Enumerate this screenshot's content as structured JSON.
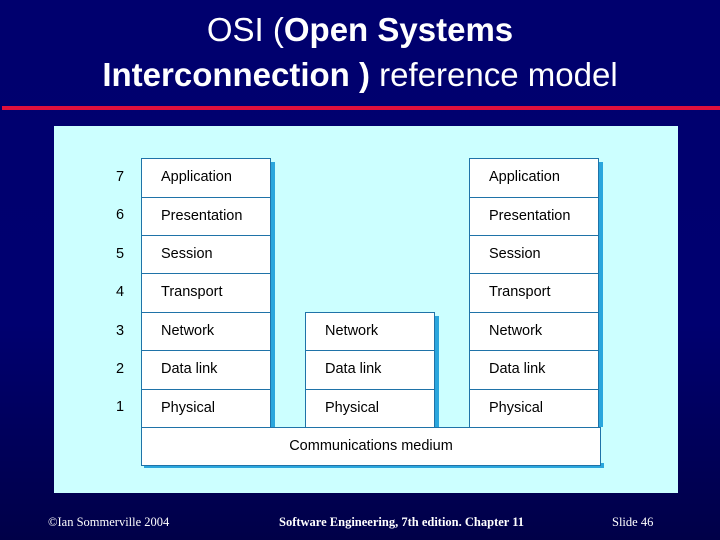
{
  "slide": {
    "title": {
      "line1_normal": "OSI (",
      "line1_bold": "Open Systems",
      "line2_bold": "Interconnection )",
      "line2_normal": " reference model"
    },
    "colors": {
      "background": "#00006e",
      "rule": "#e0103c",
      "panel": "#ccffff",
      "cell_border": "#1f73a8",
      "cell_shadow": "#2aa6dd"
    },
    "diagram": {
      "layer_numbers": [
        "7",
        "6",
        "5",
        "4",
        "3",
        "2",
        "1"
      ],
      "left_stack": [
        "Application",
        "Presentation",
        "Session",
        "Transport",
        "Network",
        "Data link",
        "Physical"
      ],
      "middle_stack": [
        "Network",
        "Data link",
        "Physical"
      ],
      "right_stack": [
        "Application",
        "Presentation",
        "Session",
        "Transport",
        "Network",
        "Data link",
        "Physical"
      ],
      "medium": "Communications medium"
    },
    "footer": {
      "left": "©Ian Sommerville 2004",
      "center": "Software Engineering, 7th edition. Chapter 11",
      "right": "Slide  46"
    }
  }
}
